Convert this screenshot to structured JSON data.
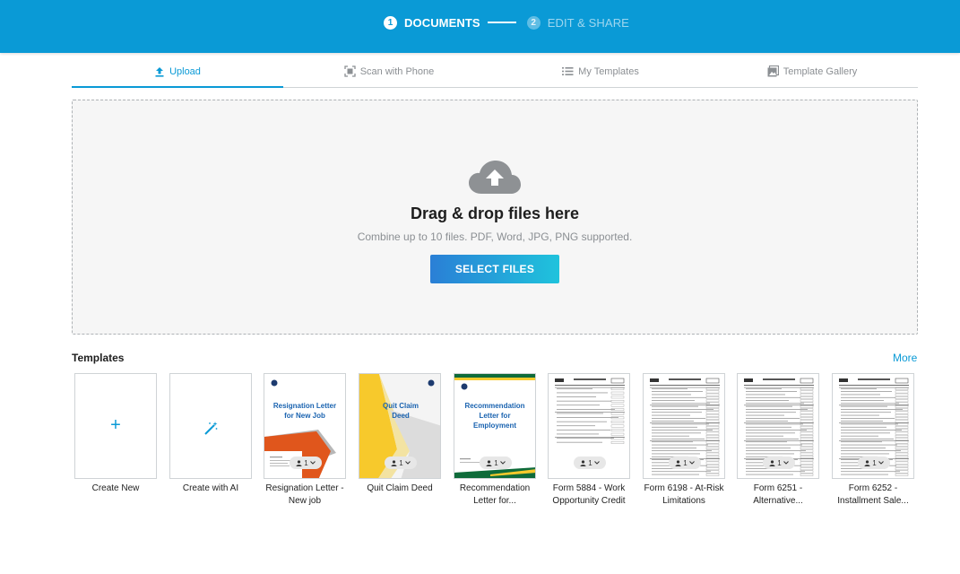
{
  "steps": [
    {
      "num": "1",
      "label": "DOCUMENTS",
      "active": true
    },
    {
      "num": "2",
      "label": "EDIT & SHARE",
      "active": false
    }
  ],
  "tabs": [
    {
      "label": "Upload",
      "icon": "upload-icon",
      "active": true
    },
    {
      "label": "Scan with Phone",
      "icon": "scan-icon",
      "active": false
    },
    {
      "label": "My Templates",
      "icon": "list-icon",
      "active": false
    },
    {
      "label": "Template Gallery",
      "icon": "gallery-icon",
      "active": false
    }
  ],
  "dropzone": {
    "icon": "cloud-upload-icon",
    "title": "Drag & drop files here",
    "subtitle": "Combine up to 10 files. PDF, Word, JPG, PNG supported.",
    "button": "SELECT FILES"
  },
  "templates": {
    "title": "Templates",
    "more": "More",
    "items": [
      {
        "label": "Create New"
      },
      {
        "label": "Create with AI"
      },
      {
        "label": "Resignation Letter - New job",
        "thumb_title": "Resignation Letter for New Job",
        "badge": "1"
      },
      {
        "label": "Quit Claim Deed",
        "thumb_title": "Quit Claim Deed",
        "badge": "1"
      },
      {
        "label": "Recommendation Letter for...",
        "thumb_title": "Recommendation Letter for Employment",
        "badge": "1"
      },
      {
        "label": "Form 5884 - Work Opportunity Credit",
        "badge": "1"
      },
      {
        "label": "Form 6198 - At-Risk Limitations",
        "badge": "1"
      },
      {
        "label": "Form 6251 - Alternative...",
        "badge": "1"
      },
      {
        "label": "Form 6252 - Installment Sale...",
        "badge": "1"
      }
    ]
  },
  "colors": {
    "brand": "#0a9ad6",
    "orange": "#e0561c",
    "yellow": "#f7c92c",
    "green": "#0f6b3a"
  }
}
